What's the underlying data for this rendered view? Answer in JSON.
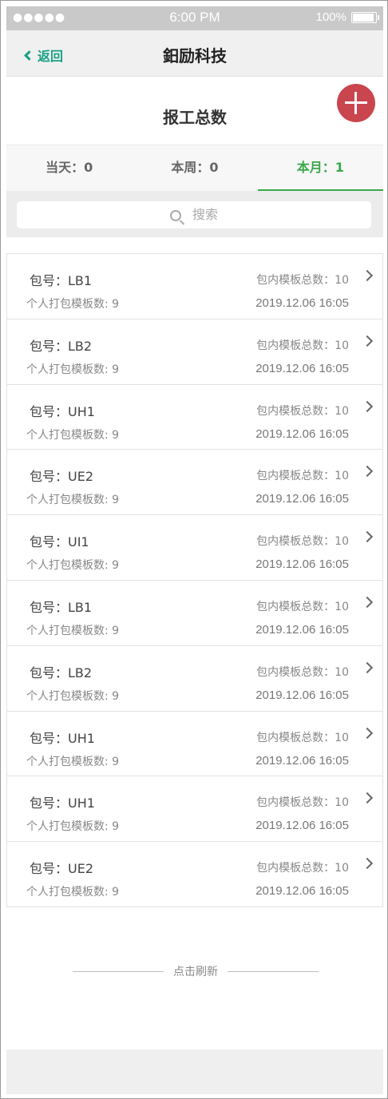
{
  "status_bar": {
    "signal": "●●●●●",
    "time": "6:00 PM",
    "battery_text": "100%"
  },
  "nav": {
    "back_label": "返回",
    "title": "鈤励科技"
  },
  "header": {
    "title": "报工总数"
  },
  "tabs": [
    {
      "label": "当天：0"
    },
    {
      "label": "本周：0"
    },
    {
      "label": "本月：1"
    }
  ],
  "search": {
    "placeholder": "搜索"
  },
  "rows": [
    {
      "pkg": "包号：LB1",
      "personal": "个人打包模板数: 9",
      "total": "包内模板总数：10",
      "date": "2019.12.06 16:05"
    },
    {
      "pkg": "包号：LB2",
      "personal": "个人打包模板数: 9",
      "total": "包内模板总数：10",
      "date": "2019.12.06 16:05"
    },
    {
      "pkg": "包号：UH1",
      "personal": "个人打包模板数: 9",
      "total": "包内模板总数：10",
      "date": "2019.12.06 16:05"
    },
    {
      "pkg": "包号：UE2",
      "personal": "个人打包模板数: 9",
      "total": "包内模板总数：10",
      "date": "2019.12.06 16:05"
    },
    {
      "pkg": "包号：UI1",
      "personal": "个人打包模板数: 9",
      "total": "包内模板总数：10",
      "date": "2019.12.06 16:05"
    },
    {
      "pkg": "包号：LB1",
      "personal": "个人打包模板数: 9",
      "total": "包内模板总数：10",
      "date": "2019.12.06 16:05"
    },
    {
      "pkg": "包号：LB2",
      "personal": "个人打包模板数: 9",
      "total": "包内模板总数：10",
      "date": "2019.12.06 16:05"
    },
    {
      "pkg": "包号：UH1",
      "personal": "个人打包模板数: 9",
      "total": "包内模板总数：10",
      "date": "2019.12.06 16:05"
    },
    {
      "pkg": "包号：UH1",
      "personal": "个人打包模板数: 9",
      "total": "包内模板总数：10",
      "date": "2019.12.06 16:05"
    },
    {
      "pkg": "包号：UE2",
      "personal": "个人打包模板数: 9",
      "total": "包内模板总数：10",
      "date": "2019.12.06 16:05"
    }
  ],
  "refresh": {
    "label": "点击刷新"
  },
  "colors": {
    "accent": "#16a086",
    "tab_active": "#3aa84a",
    "fab": "#c9464f"
  }
}
